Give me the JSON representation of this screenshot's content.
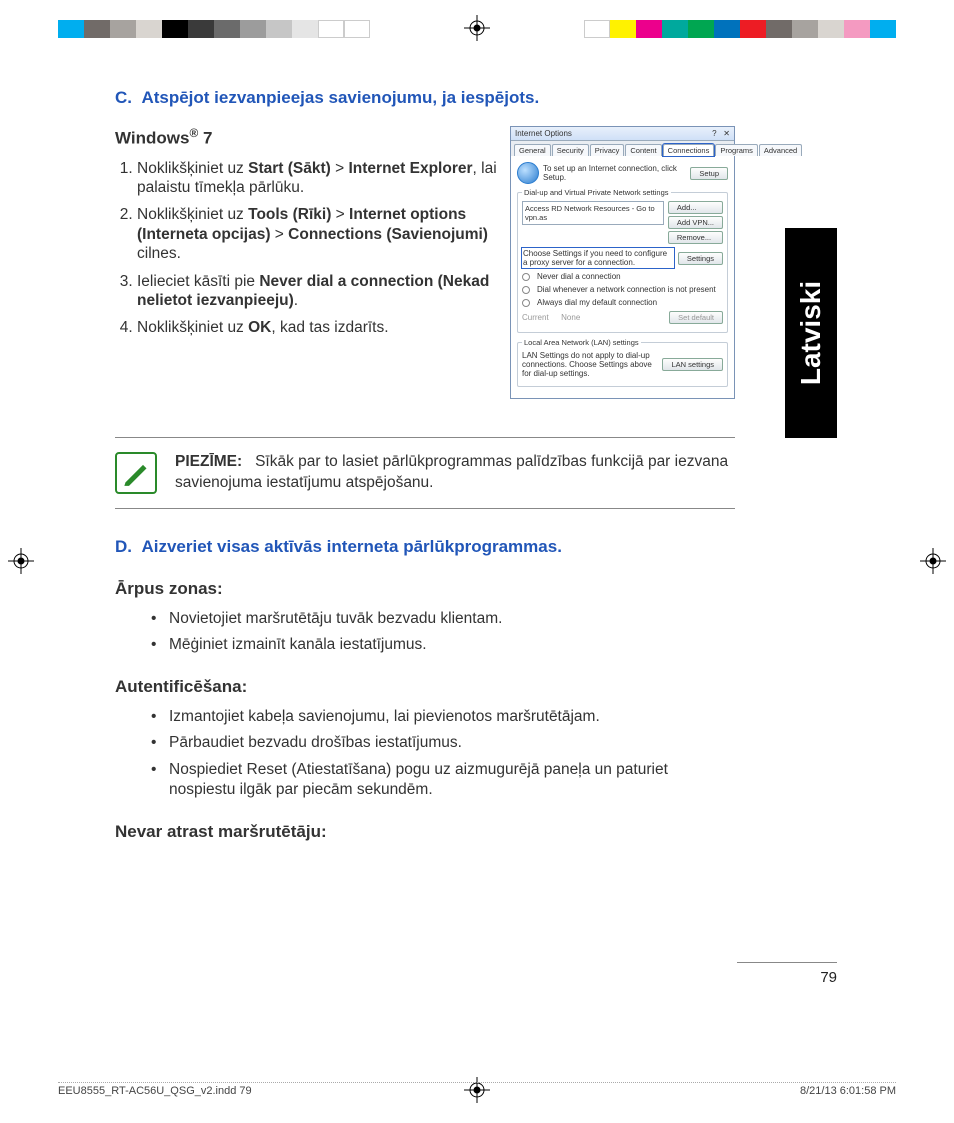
{
  "language_tab": "Latviski",
  "section_c": {
    "letter": "C.",
    "title": "Atspējot iezvanpieejas savienojumu, ja iespējots."
  },
  "windows_heading_prefix": "Windows",
  "windows_heading_suffix": " 7",
  "steps": [
    {
      "pre": "Noklikšķiniet uz ",
      "b1": "Start (Sākt)",
      "mid1": " > ",
      "b2": "Internet Explorer",
      "post": ", lai palaistu tīmekļa pārlūku."
    },
    {
      "pre": "Noklikšķiniet uz ",
      "b1": "Tools (Rīki)",
      "mid1": " > ",
      "b2": "Internet options (Interneta opcijas)",
      "mid2": " > ",
      "b3": "Connections (Savienojumi)",
      "post": " cilnes."
    },
    {
      "pre": "Ielieciet kāsīti pie ",
      "b1": "Never dial a connection (Nekad nelietot iezvanpieeju)",
      "post": "."
    },
    {
      "pre": "Noklikšķiniet uz ",
      "b1": "OK",
      "post": ", kad tas izdarīts."
    }
  ],
  "dialog": {
    "title": "Internet Options",
    "tabs": [
      "General",
      "Security",
      "Privacy",
      "Content",
      "Connections",
      "Programs",
      "Advanced"
    ],
    "setup_text": "To set up an Internet connection, click Setup.",
    "setup_btn": "Setup",
    "dialup_legend": "Dial-up and Virtual Private Network settings",
    "list_item": "Access RD Network Resources - Go to vpn.as",
    "btn_add": "Add...",
    "btn_addvpn": "Add VPN...",
    "btn_remove": "Remove...",
    "proxy_text": "Choose Settings if you need to configure a proxy server for a connection.",
    "btn_settings": "Settings",
    "radio1": "Never dial a connection",
    "radio2": "Dial whenever a network connection is not present",
    "radio3": "Always dial my default connection",
    "current_label": "Current",
    "current_value": "None",
    "btn_setdefault": "Set default",
    "lan_legend": "Local Area Network (LAN) settings",
    "lan_text": "LAN Settings do not apply to dial-up connections. Choose Settings above for dial-up settings.",
    "btn_lan": "LAN settings"
  },
  "note_label": "PIEZĪME:",
  "note_text": "Sīkāk par to lasiet pārlūkprogrammas palīdzības funkcijā par iezvana savienojuma iestatījumu atspējošanu.",
  "section_d": {
    "letter": "D.",
    "title": "Aizveriet visas aktīvās interneta pārlūkprogrammas."
  },
  "out_of_range_heading": "Ārpus zonas:",
  "out_of_range_items": [
    "Novietojiet maršrutētāju tuvāk bezvadu klientam.",
    "Mēģiniet izmainīt kanāla iestatījumus."
  ],
  "auth_heading": "Autentificēšana:",
  "auth_items": [
    "Izmantojiet kabeļa savienojumu, lai pievienotos maršrutētājam.",
    "Pārbaudiet bezvadu drošības iestatījumus.",
    "Nospiediet Reset (Atiestatīšana) pogu uz aizmugurējā paneļa un paturiet nospiestu ilgāk par piecām sekundēm."
  ],
  "norouter_heading": "Nevar atrast maršrutētāju:",
  "page_number": "79",
  "footer_file": "EEU8555_RT-AC56U_QSG_v2.indd   79",
  "footer_date": "8/21/13   6:01:58 PM",
  "swatches_left": [
    "#00aeef",
    "#716b68",
    "#a7a39f",
    "#d9d5d0",
    "#000000",
    "#3a3a3a",
    "#6b6b6b",
    "#9c9c9c",
    "#c6c6c6",
    "#e5e5e5",
    "#ffffff",
    "#ffffff"
  ],
  "swatches_right": [
    "#ffffff",
    "#fff200",
    "#ec008c",
    "#00a99d",
    "#00a651",
    "#0072bc",
    "#ed1c24",
    "#716b68",
    "#a7a39f",
    "#d9d5d0",
    "#f49ac1",
    "#00aeef"
  ]
}
